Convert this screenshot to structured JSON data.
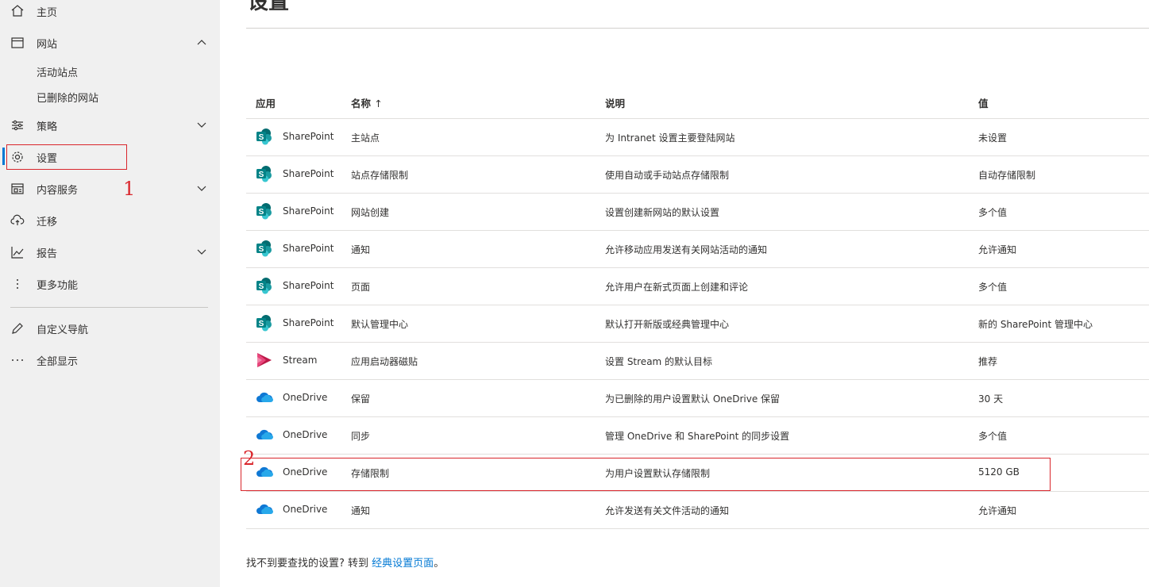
{
  "page_title": "设置",
  "sidebar": {
    "items": [
      {
        "id": "home",
        "label": "主页",
        "icon": "home-icon"
      },
      {
        "id": "sites",
        "label": "网站",
        "icon": "browser-window-icon",
        "chevron": "chevron-up-icon"
      },
      {
        "id": "policies",
        "label": "策略",
        "icon": "sliders-icon",
        "chevron": "chevron-down-icon"
      },
      {
        "id": "settings",
        "label": "设置",
        "icon": "gear-icon"
      },
      {
        "id": "content-services",
        "label": "内容服务",
        "icon": "content-services-icon",
        "chevron": "chevron-down-icon"
      },
      {
        "id": "migration",
        "label": "迁移",
        "icon": "cloud-upload-icon"
      },
      {
        "id": "reports",
        "label": "报告",
        "icon": "line-chart-icon",
        "chevron": "chevron-down-icon"
      },
      {
        "id": "more",
        "label": "更多功能",
        "icon": "more-vertical-icon"
      },
      {
        "id": "customize-nav",
        "label": "自定义导航",
        "icon": "pencil-icon"
      },
      {
        "id": "show-all",
        "label": "全部显示",
        "icon": "more-horizontal-icon"
      }
    ],
    "sub_items": [
      "活动站点",
      "已删除的网站"
    ]
  },
  "annotations": [
    "1",
    "2"
  ],
  "table": {
    "headers": {
      "app": "应用",
      "name": "名称",
      "name_sort": "↑",
      "desc": "说明",
      "value": "值"
    },
    "rows": [
      {
        "app": "SharePoint",
        "name": "主站点",
        "desc": "为 Intranet 设置主要登陆网站",
        "value": "未设置"
      },
      {
        "app": "SharePoint",
        "name": "站点存储限制",
        "desc": "使用自动或手动站点存储限制",
        "value": "自动存储限制"
      },
      {
        "app": "SharePoint",
        "name": "网站创建",
        "desc": "设置创建新网站的默认设置",
        "value": "多个值"
      },
      {
        "app": "SharePoint",
        "name": "通知",
        "desc": "允许移动应用发送有关网站活动的通知",
        "value": "允许通知"
      },
      {
        "app": "SharePoint",
        "name": "页面",
        "desc": "允许用户在新式页面上创建和评论",
        "value": "多个值"
      },
      {
        "app": "SharePoint",
        "name": "默认管理中心",
        "desc": "默认打开新版或经典管理中心",
        "value": "新的 SharePoint 管理中心"
      },
      {
        "app": "Stream",
        "name": "应用启动器磁贴",
        "desc": "设置 Stream 的默认目标",
        "value": "推荐"
      },
      {
        "app": "OneDrive",
        "name": "保留",
        "desc": "为已删除的用户设置默认 OneDrive 保留",
        "value": "30 天"
      },
      {
        "app": "OneDrive",
        "name": "同步",
        "desc": "管理 OneDrive 和 SharePoint 的同步设置",
        "value": "多个值"
      },
      {
        "app": "OneDrive",
        "name": "存储限制",
        "desc": "为用户设置默认存储限制",
        "value": "5120 GB"
      },
      {
        "app": "OneDrive",
        "name": "通知",
        "desc": "允许发送有关文件活动的通知",
        "value": "允许通知"
      }
    ]
  },
  "footer": {
    "text": "找不到要查找的设置? 转到 ",
    "link": "经典设置页面",
    "end": "。"
  },
  "colors": {
    "accent": "#0078d4",
    "annotation": "#d9262c",
    "sharepoint": "#038387",
    "stream": "#bc1948",
    "onedrive": "#0f78d4"
  }
}
